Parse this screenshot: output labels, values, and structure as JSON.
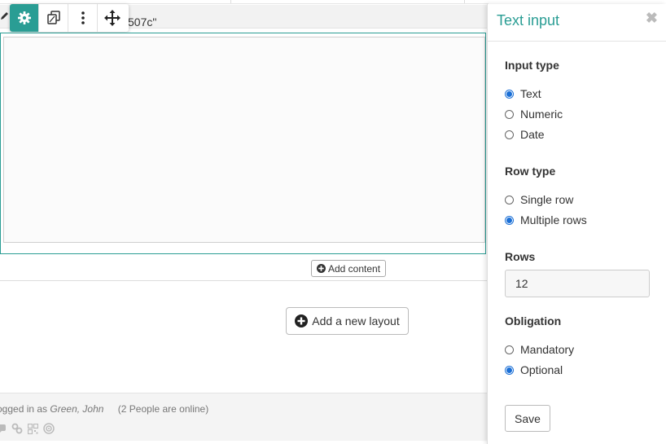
{
  "editor": {
    "crumb_text": "507c\"",
    "add_content_label": "Add content",
    "add_layout_label": "Add a new layout"
  },
  "toolbar": {
    "items": [
      {
        "icon": "gear-icon",
        "active": true
      },
      {
        "icon": "copy-icon",
        "active": false
      },
      {
        "icon": "more-vertical-icon",
        "active": false
      },
      {
        "icon": "move-icon",
        "active": false
      }
    ]
  },
  "footer": {
    "logged_prefix": "ogged in as",
    "user": "Green, John",
    "online": "(2 People are online)"
  },
  "panel": {
    "title": "Text input",
    "input_type": {
      "title": "Input type",
      "options": [
        "Text",
        "Numeric",
        "Date"
      ],
      "selected": "Text"
    },
    "row_type": {
      "title": "Row type",
      "options": [
        "Single row",
        "Multiple rows"
      ],
      "selected": "Multiple rows"
    },
    "rows": {
      "title": "Rows",
      "value": "12"
    },
    "obligation": {
      "title": "Obligation",
      "options": [
        "Mandatory",
        "Optional"
      ],
      "selected": "Optional"
    },
    "save_label": "Save"
  },
  "colors": {
    "accent": "#2a9d94",
    "radio_selected": "#1a6fd6"
  }
}
